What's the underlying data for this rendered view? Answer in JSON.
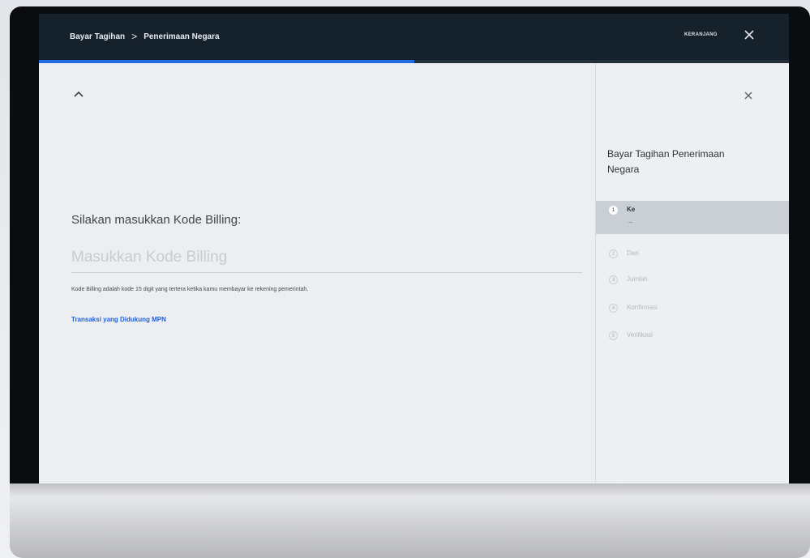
{
  "header": {
    "breadcrumb": [
      "Bayar Tagihan",
      "Penerimaan Negara"
    ],
    "breadcrumb_separator": ">",
    "cart_label": "KERANJANG",
    "close_icon": "close-icon"
  },
  "progress": {
    "fraction": 0.5
  },
  "main": {
    "collapse_icon": "chevron-up-icon",
    "prompt": "Silakan masukkan Kode Billing:",
    "input_placeholder": "Masukkan Kode Billing",
    "input_value": "",
    "hint": "Kode Billing adalah kode 15 digit yang tertera ketika kamu membayar ke rekening pemerintah.",
    "link_text": "Transaksi yang Didukung MPN"
  },
  "side_panel": {
    "close_icon": "close-icon",
    "title": "Bayar Tagihan Penerimaan Negara",
    "steps": [
      {
        "number": "1",
        "label": "Ke",
        "sub": "--",
        "active": true
      },
      {
        "number": "2",
        "label": "Dari",
        "active": false
      },
      {
        "number": "3",
        "label": "Jumlah",
        "active": false
      },
      {
        "number": "4",
        "label": "Konfirmasi",
        "active": false
      },
      {
        "number": "5",
        "label": "Verifikasi",
        "active": false
      }
    ]
  },
  "colors": {
    "header_bg": "#15212b",
    "accent": "#1f6de0",
    "link": "#1f5fd6",
    "active_step_bg": "#c9cfd5"
  }
}
